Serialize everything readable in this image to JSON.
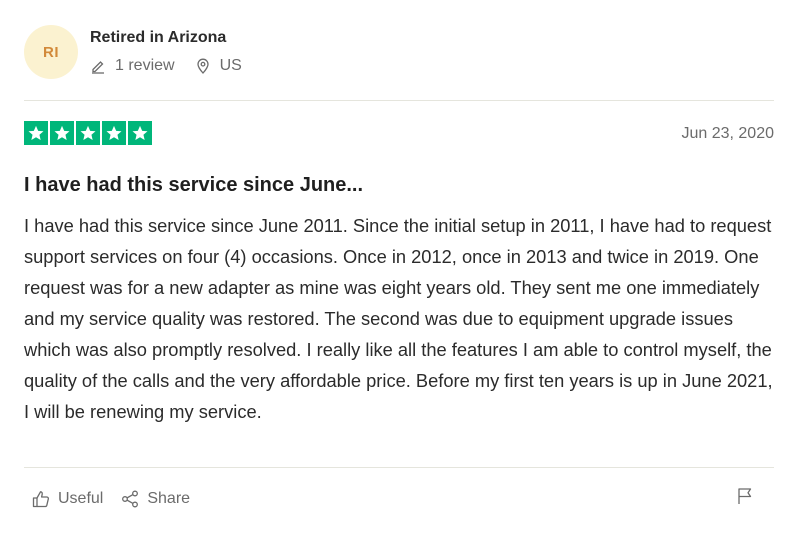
{
  "reviewer": {
    "initials": "RI",
    "name": "Retired in Arizona",
    "review_count": "1 review",
    "country": "US",
    "avatar_bg": "#fbf2d0",
    "avatar_fg": "#d28a3a"
  },
  "review": {
    "rating": 5,
    "max_rating": 5,
    "star_color": "#00b67a",
    "date": "Jun 23, 2020",
    "title": "I have had this service since June...",
    "body": "I have had this service since June 2011. Since the initial setup in 2011, I have had to request support services on four (4) occasions. Once in 2012, once in 2013 and twice in 2019. One request was for a new adapter as mine was eight years old. They sent me one immediately and my service quality was restored. The second was due to equipment upgrade issues which was also promptly resolved. I really like all the features I am able to control myself, the quality of the calls and the very affordable price. Before my first ten years is up in June 2021, I will be renewing my service."
  },
  "actions": {
    "useful_label": "Useful",
    "share_label": "Share"
  },
  "icons": {
    "review_count": "pencil-icon",
    "country": "location-pin-icon",
    "useful": "thumbs-up-icon",
    "share": "share-icon",
    "report": "flag-icon",
    "rating": "star-icon"
  }
}
